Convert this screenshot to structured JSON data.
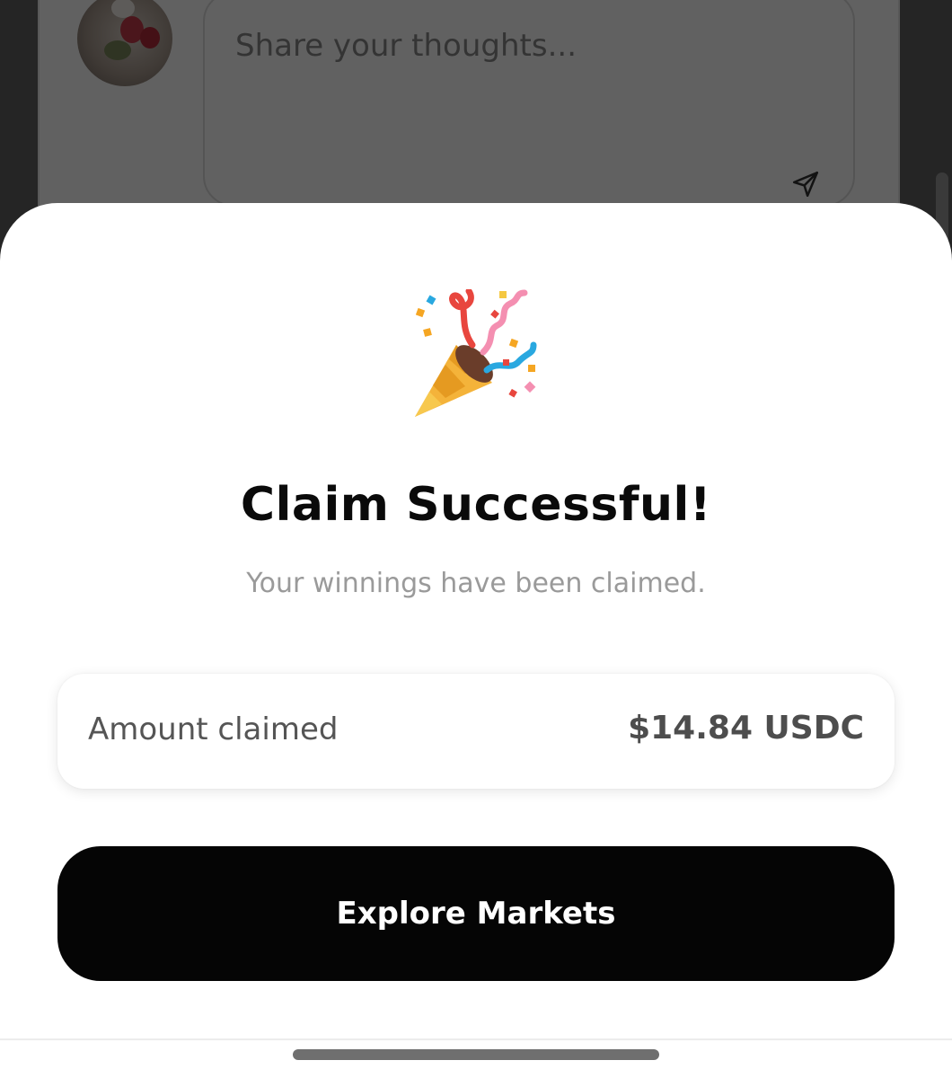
{
  "comment_box": {
    "placeholder": "Share your thoughts..."
  },
  "icons": {
    "send": "send-icon",
    "celebration": "party-popper-icon"
  },
  "sheet": {
    "title": "Claim Successful!",
    "subtitle": "Your winnings have been claimed.",
    "amount_label": "Amount claimed",
    "amount_value": "$14.84 USDC",
    "primary_button": "Explore Markets"
  },
  "colors": {
    "button_bg": "#050505",
    "button_text": "#ffffff",
    "title": "#0a0a0a",
    "subtitle": "#9a9a9a"
  }
}
